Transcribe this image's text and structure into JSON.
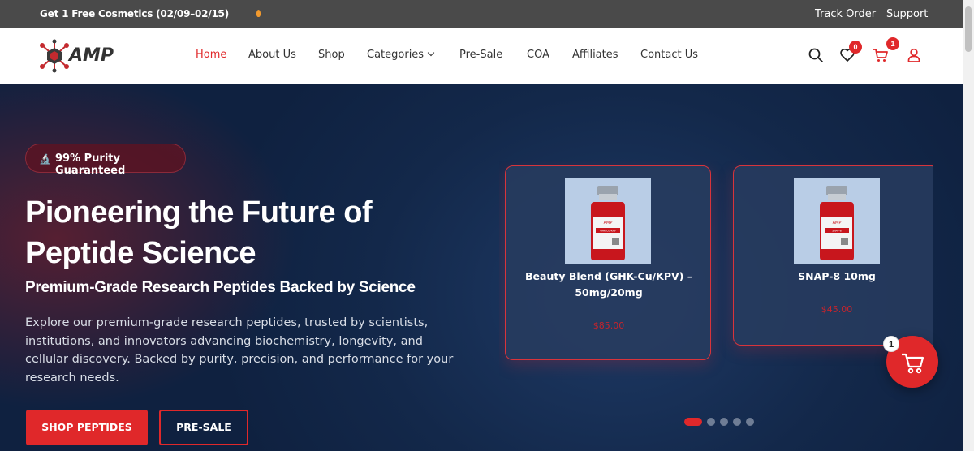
{
  "topbar": {
    "promo": "Get 1 Free Cosmetics (02/09–02/15)",
    "links": {
      "track": "Track Order",
      "support": "Support"
    }
  },
  "nav": {
    "logo_text": "AMP",
    "items": [
      {
        "label": "Home",
        "active": true
      },
      {
        "label": "About Us"
      },
      {
        "label": "Shop"
      },
      {
        "label": "Categories"
      },
      {
        "label": "Pre-Sale"
      },
      {
        "label": "COA"
      },
      {
        "label": "Affiliates"
      },
      {
        "label": "Contact Us"
      }
    ],
    "wishlist_count": "0",
    "cart_count": "1"
  },
  "hero": {
    "pill": "99% Purity Guaranteed",
    "title_line1": "Pioneering the Future of",
    "title_line2": "Peptide Science",
    "subtitle": "Premium-Grade Research Peptides Backed by Science",
    "description": "Explore our premium-grade research peptides, trusted by scientists, institutions, and innovators advancing biochemistry, longevity, and cellular discovery. Backed by purity, precision, and performance for your research needs.",
    "btn_shop": "SHOP PEPTIDES",
    "btn_presale": "PRE-SALE"
  },
  "products": [
    {
      "name_line1": "Beauty Blend (GHK-Cu/KPV) –",
      "name_line2": "50mg/20mg",
      "price": "$85.00",
      "label_text": "GHK-CU/KPV"
    },
    {
      "name_line1": "SNAP-8 10mg",
      "name_line2": "",
      "price": "$45.00",
      "label_text": "SNAP-8"
    }
  ],
  "carousel": {
    "slides": 5,
    "active": 1
  },
  "floating_cart_count": "1",
  "colors": {
    "accent": "#e0282a",
    "hero_bg": "#13284a",
    "topbar": "#4a4a4a"
  }
}
